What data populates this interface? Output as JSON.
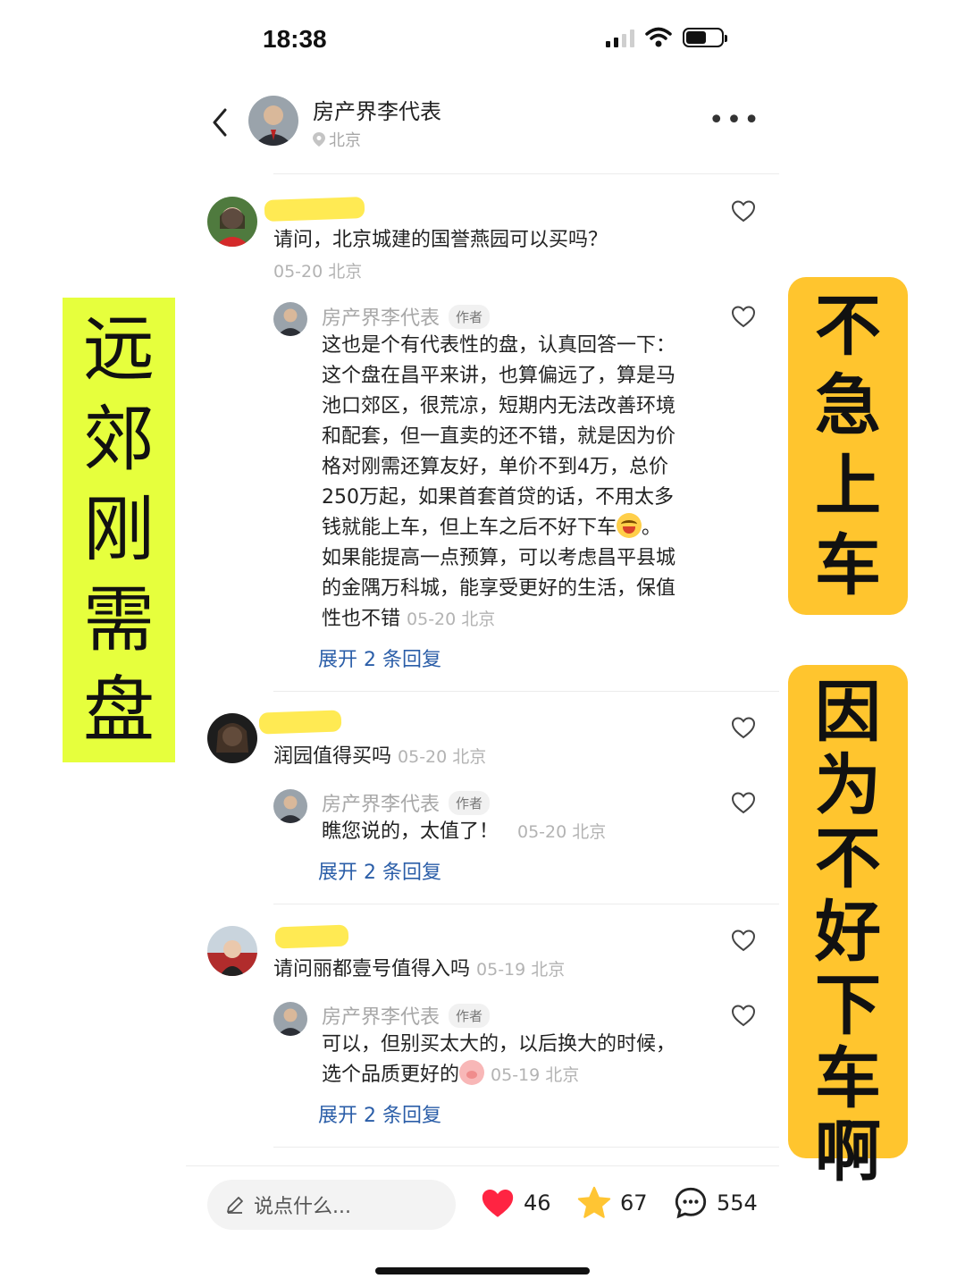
{
  "status_bar": {
    "time": "18:38"
  },
  "header": {
    "title": "房产界李代表",
    "location": "北京"
  },
  "comments": [
    {
      "text": "请问，北京城建的国誉燕园可以买吗？",
      "meta": "05-20 北京",
      "reply": {
        "author": "房产界李代表",
        "badge": "作者",
        "lines": [
          "这也是个有代表性的盘，认真回答一下：",
          "这个盘在昌平来讲，也算偏远了，算是马",
          "池口郊区，很荒凉，短期内无法改善环境",
          "和配套，但一直卖的还不错，就是因为价",
          "格对刚需还算友好，单价不到4万，总价",
          "250万起，如果首套首贷的话，不用太多",
          "钱就能上车，但上车之后不好下车",
          "如果能提高一点预算，可以考虑昌平县城",
          "的金隅万科城，能享受更好的生活，保值",
          "性也不错"
        ],
        "line7_tail": "。",
        "meta": "05-20 北京",
        "expand": "展开 2 条回复"
      }
    },
    {
      "text": "润园值得买吗",
      "meta": "05-20 北京",
      "reply": {
        "author": "房产界李代表",
        "badge": "作者",
        "text": "瞧您说的，太值了！",
        "meta": "05-20 北京",
        "expand": "展开 2 条回复"
      }
    },
    {
      "text": "请问丽都壹号值得入吗",
      "meta": "05-19 北京",
      "reply": {
        "author": "房产界李代表",
        "badge": "作者",
        "line1": "可以，但别买太大的，以后换大的时候，",
        "line2": "选个品质更好的",
        "meta": "05-19 北京",
        "expand": "展开 2 条回复"
      }
    }
  ],
  "banners": {
    "left": [
      "远",
      "郊",
      "刚",
      "需",
      "盘"
    ],
    "right_top": [
      "不",
      "急",
      "上",
      "车"
    ],
    "right_bottom": [
      "因",
      "为",
      "不",
      "好",
      "下",
      "车",
      "啊"
    ]
  },
  "bottom_bar": {
    "input_placeholder": "说点什么...",
    "likes": "46",
    "stars": "67",
    "comments": "554"
  },
  "colors": {
    "left_banner": "#e6ff3d",
    "right_banner": "#ffc52e",
    "link": "#2b5ea8",
    "heart": "#ff2442",
    "star": "#ffc533"
  }
}
